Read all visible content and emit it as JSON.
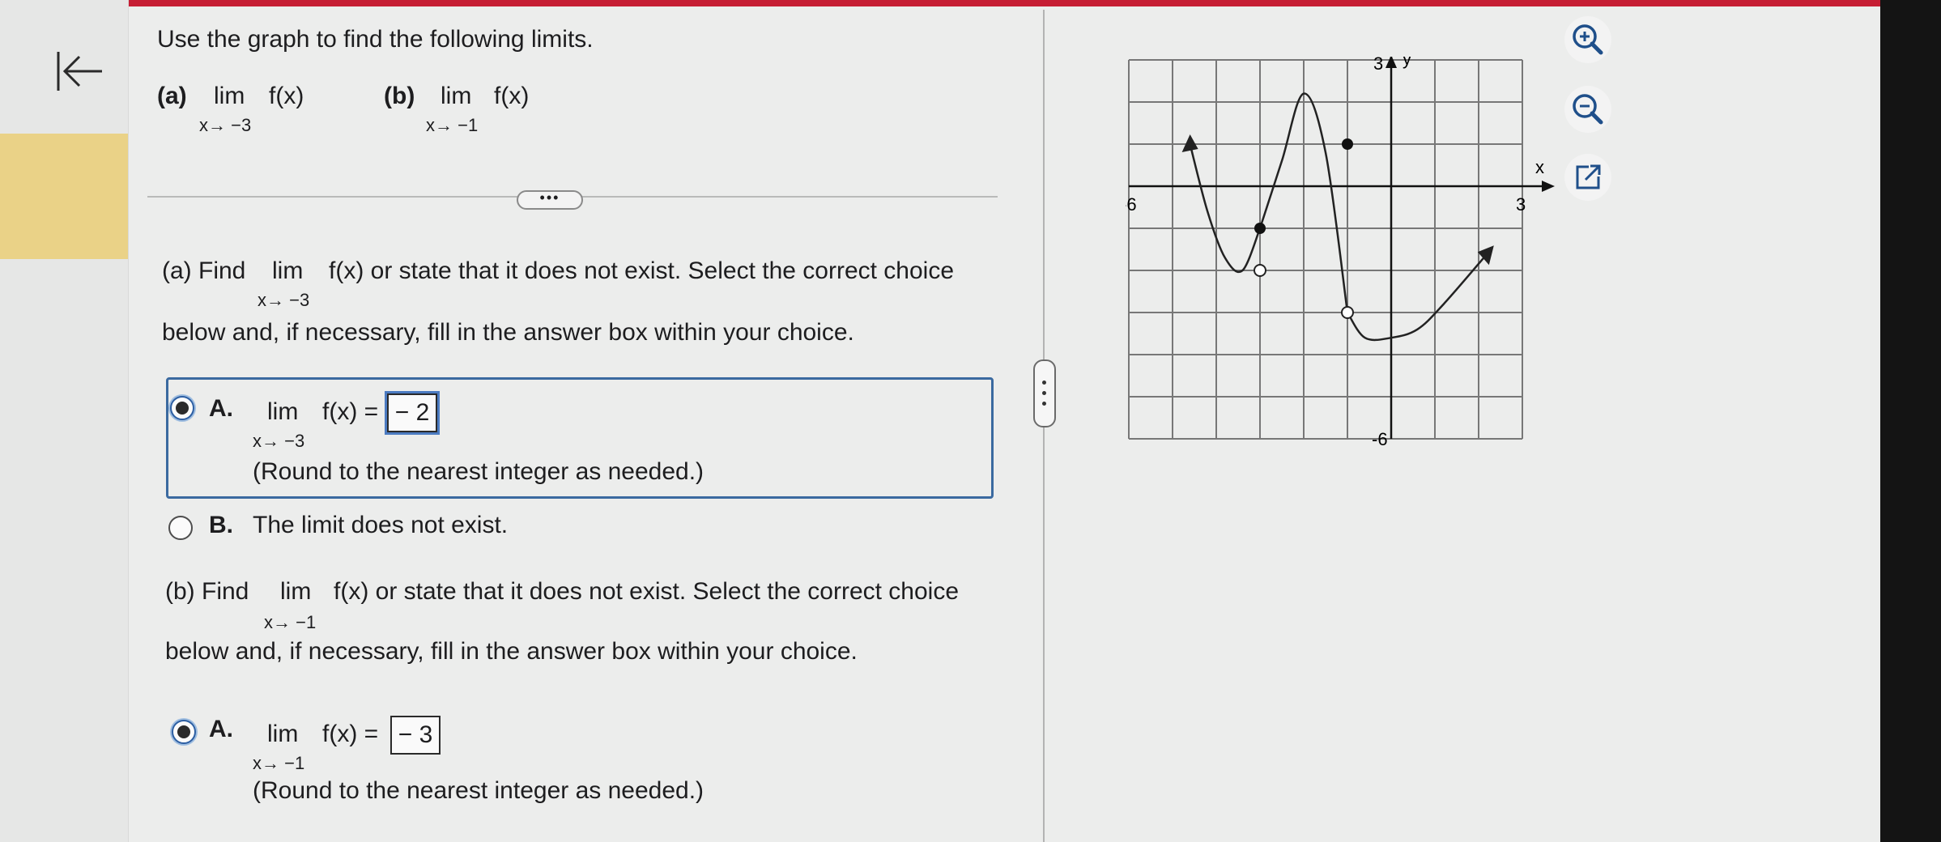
{
  "question": {
    "prompt": "Use the graph to find the following limits.",
    "part_a_label": "(a)",
    "part_b_label": "(b)",
    "lim": "lim",
    "fx": "f(x)",
    "a_approach": "x→ −3",
    "b_approach": "x→ −1"
  },
  "part_a": {
    "find_label": "(a) Find",
    "lim": "lim",
    "fx_text": "f(x) or state that it does not exist. Select the correct choice",
    "approach": "x→ −3",
    "line2": "below and, if necessary, fill in the answer box within your choice.",
    "choice_a": {
      "letter": "A.",
      "lim": "lim",
      "approach": "x→ −3",
      "fx_eq": "f(x) =",
      "answer": "− 2",
      "note": "(Round to the nearest integer as needed.)",
      "selected": true
    },
    "choice_b": {
      "letter": "B.",
      "text": "The limit does not exist.",
      "selected": false
    }
  },
  "part_b": {
    "find_label": "(b) Find",
    "lim": "lim",
    "fx_text": "f(x) or state that it does not exist. Select the correct choice",
    "approach": "x→ −1",
    "line2": "below and, if necessary, fill in the answer box within your choice.",
    "choice_a": {
      "letter": "A.",
      "lim": "lim",
      "approach": "x→ −1",
      "fx_eq": "f(x) =",
      "answer": "− 3",
      "note": "(Round to the nearest integer as needed.)",
      "selected": true
    }
  },
  "graph": {
    "x_axis_label": "x",
    "y_axis_label": "y",
    "x_min_label": "-6",
    "x_max_label": "3",
    "y_max_label": "3",
    "y_min_label": "-6",
    "x_range": [
      -6,
      3
    ],
    "y_range": [
      -6,
      3
    ],
    "grid": true
  },
  "chart_data": {
    "type": "line",
    "xlim": [
      -6,
      3
    ],
    "ylim": [
      -6,
      3
    ],
    "pieces": [
      {
        "x": [
          -4.6,
          -4.2,
          -3.8,
          -3.4,
          -3.0
        ],
        "y": [
          1.0,
          -0.6,
          -1.7,
          -2.0,
          -1.0
        ]
      },
      {
        "x": [
          -3.0,
          -2.5,
          -2.0,
          -1.5,
          -1.0
        ],
        "y": [
          -1.0,
          0.6,
          2.2,
          0.8,
          -3.0
        ]
      },
      {
        "x": [
          -1.0,
          -0.6,
          0.0,
          0.6,
          1.2,
          2.2
        ],
        "y": [
          -3.0,
          -3.6,
          -3.6,
          -3.4,
          -2.8,
          -1.6
        ]
      }
    ],
    "open_points": [
      {
        "x": -3,
        "y": -2
      },
      {
        "x": -1,
        "y": -3
      }
    ],
    "closed_points": [
      {
        "x": -3,
        "y": -1
      },
      {
        "x": -1,
        "y": 1
      }
    ],
    "arrows": [
      {
        "x": -4.6,
        "y": 1.0
      },
      {
        "x": 2.2,
        "y": -1.6
      }
    ]
  },
  "tools": {
    "zoom_in": "zoom-in-icon",
    "zoom_out": "zoom-out-icon",
    "popout": "external-link-icon"
  },
  "colors": {
    "accent": "#3b6aa0",
    "rail_highlight": "#ead287",
    "top_bar": "#c61e34"
  }
}
